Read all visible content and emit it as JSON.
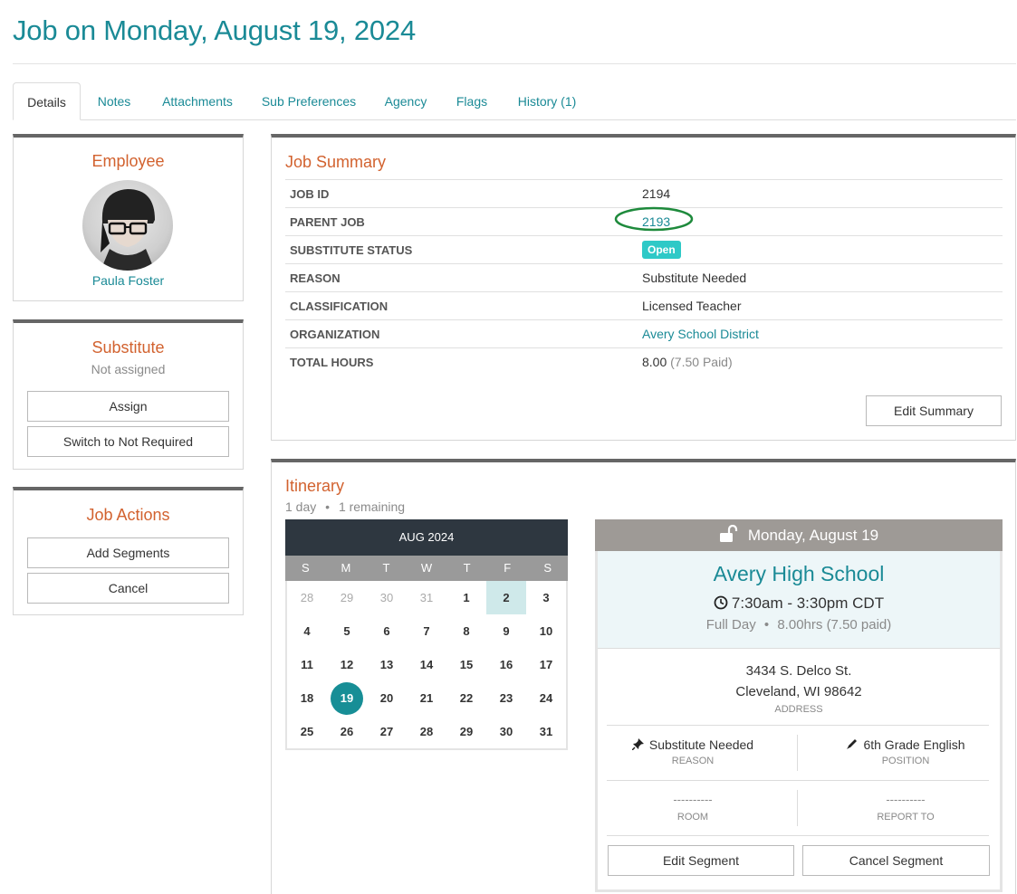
{
  "page_title": "Job on Monday, August 19, 2024",
  "tabs": [
    {
      "label": "Details"
    },
    {
      "label": "Notes"
    },
    {
      "label": "Attachments"
    },
    {
      "label": "Sub Preferences"
    },
    {
      "label": "Agency"
    },
    {
      "label": "Flags"
    },
    {
      "label": "History (1)"
    }
  ],
  "employee": {
    "heading": "Employee",
    "name": "Paula Foster"
  },
  "substitute": {
    "heading": "Substitute",
    "status": "Not assigned",
    "assign_label": "Assign",
    "switch_label": "Switch to Not Required"
  },
  "job_actions": {
    "heading": "Job Actions",
    "add_segments_label": "Add Segments",
    "cancel_label": "Cancel"
  },
  "job_summary": {
    "heading": "Job Summary",
    "rows": [
      {
        "key": "JOB ID",
        "value": "2194"
      },
      {
        "key": "PARENT JOB",
        "value": "2193"
      },
      {
        "key": "SUBSTITUTE STATUS",
        "value": "Open"
      },
      {
        "key": "REASON",
        "value": "Substitute Needed"
      },
      {
        "key": "CLASSIFICATION",
        "value": "Licensed Teacher"
      },
      {
        "key": "ORGANIZATION",
        "value": "Avery School District"
      },
      {
        "key": "TOTAL HOURS",
        "value": "8.00",
        "extra": "(7.50 Paid)"
      }
    ],
    "edit_label": "Edit Summary"
  },
  "itinerary": {
    "heading": "Itinerary",
    "days": "1 day",
    "remaining": "1 remaining",
    "calendar": {
      "month_label": "AUG 2024",
      "dow": [
        "S",
        "M",
        "T",
        "W",
        "T",
        "F",
        "S"
      ],
      "days": [
        "28",
        "29",
        "30",
        "31",
        "1",
        "2",
        "3",
        "4",
        "5",
        "6",
        "7",
        "8",
        "9",
        "10",
        "11",
        "12",
        "13",
        "14",
        "15",
        "16",
        "17",
        "18",
        "19",
        "20",
        "21",
        "22",
        "23",
        "24",
        "25",
        "26",
        "27",
        "28",
        "29",
        "30",
        "31"
      ]
    },
    "segment": {
      "date": "Monday, August 19",
      "school": "Avery High School",
      "time": "7:30am - 3:30pm CDT",
      "duration": "Full Day",
      "hours": "8.00hrs",
      "paid": "(7.50 paid)",
      "address_line1": "3434 S. Delco St.",
      "address_line2": "Cleveland, WI 98642",
      "address_caption": "ADDRESS",
      "reason": "Substitute Needed",
      "reason_caption": "REASON",
      "position": "6th Grade English",
      "position_caption": "POSITION",
      "room": "----------",
      "room_caption": "ROOM",
      "report_to": "----------",
      "report_to_caption": "REPORT TO",
      "edit_label": "Edit Segment",
      "cancel_label": "Cancel Segment"
    }
  },
  "colors": {
    "teal": "#1a8a96",
    "orange": "#d2622f",
    "badge": "#2ec9c7",
    "annotation_ring": "#1e8a3c"
  }
}
